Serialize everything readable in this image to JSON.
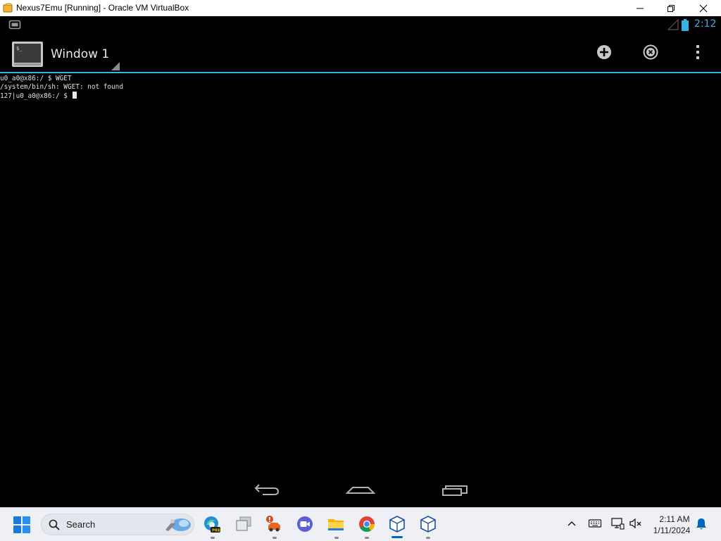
{
  "window": {
    "title": "Nexus7Emu [Running] - Oracle VM VirtualBox",
    "controls": [
      "minimize-icon",
      "restore-icon",
      "close-icon"
    ]
  },
  "android": {
    "status_bar": {
      "clock": "2:12",
      "accent": "#33b5e5"
    },
    "action_bar": {
      "window_title": "Window 1",
      "actions": [
        "add-window-icon",
        "close-window-icon",
        "overflow-menu-icon"
      ]
    },
    "terminal": {
      "lines": [
        "u0_a0@x86:/ $ WGET",
        "/system/bin/sh: WGET: not found",
        "127|u0_a0@x86:/ $ "
      ]
    },
    "nav_bar": [
      "back-icon",
      "home-icon",
      "recents-icon"
    ]
  },
  "taskbar": {
    "search_label": "Search",
    "apps": [
      "start-icon",
      "edge-beta-icon",
      "task-view-icon",
      "teams-alert-icon",
      "zoom-icon",
      "file-explorer-icon",
      "chrome-icon",
      "virtualbox-icon",
      "virtualbox-icon-2"
    ],
    "tray": [
      "chevron-up-icon",
      "keyboard-icon",
      "network-icon",
      "volume-muted-icon",
      "notification-bell-icon"
    ],
    "clock": {
      "time": "2:11 AM",
      "date": "1/11/2024"
    }
  }
}
